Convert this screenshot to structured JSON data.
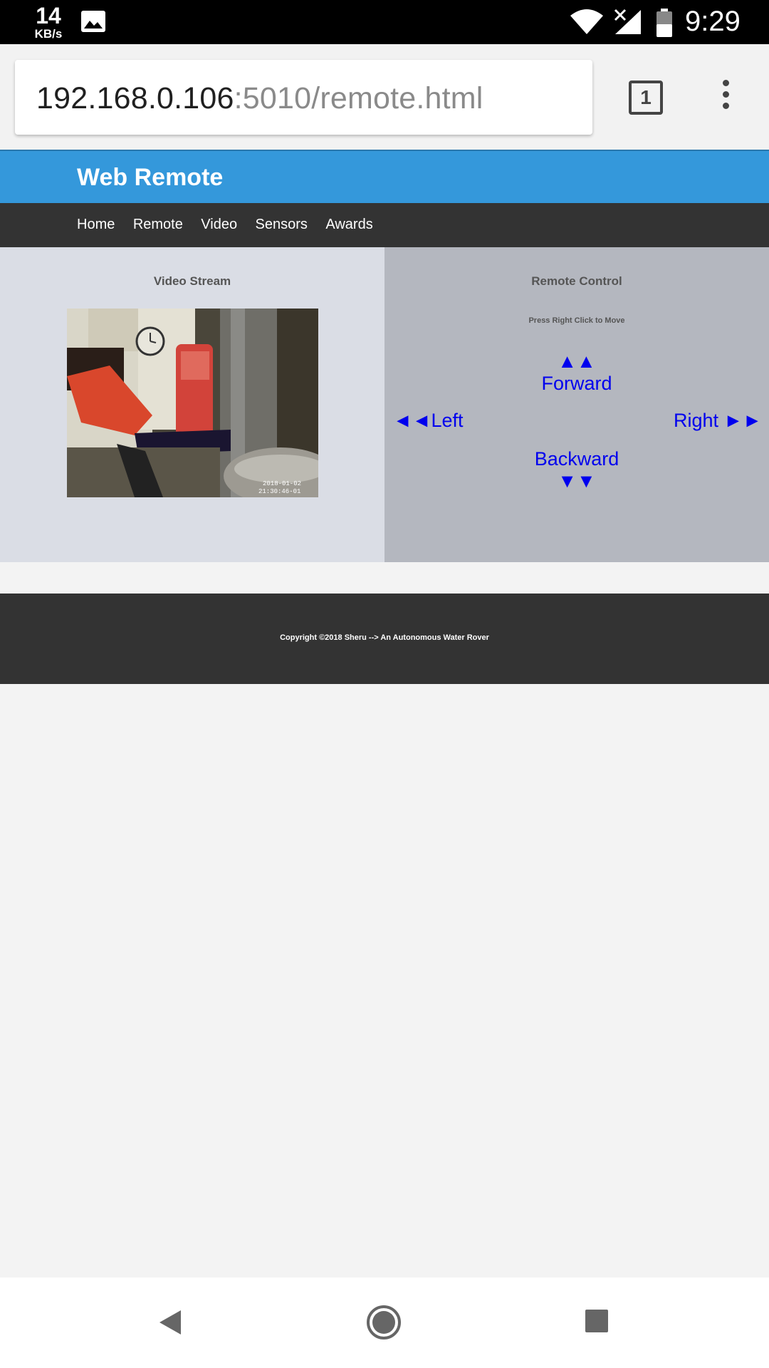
{
  "status_bar": {
    "net_speed": "14",
    "net_unit": "KB/s",
    "time": "9:29",
    "icons": [
      "gallery-icon",
      "wifi-icon",
      "signal-icon",
      "battery-icon"
    ]
  },
  "browser": {
    "url_host": "192.168.0.106",
    "url_path": ":5010/remote.html",
    "tab_count": "1"
  },
  "site": {
    "title": "Web Remote",
    "nav": [
      "Home",
      "Remote",
      "Video",
      "Sensors",
      "Awards"
    ],
    "colors": {
      "header": "#3498db",
      "nav": "#333333",
      "link": "#0000ee"
    }
  },
  "video_panel": {
    "title": "Video Stream",
    "timestamp_line1": "2018-01-02",
    "timestamp_line2": "21:30:46-01"
  },
  "remote_panel": {
    "title": "Remote Control",
    "hint": "Press Right Click to Move",
    "forward_arrows": "▲▲",
    "forward": "Forward",
    "left_arrows": "◄◄",
    "left": "Left",
    "right": "Right",
    "right_arrows": "►►",
    "backward": "Backward",
    "backward_arrows": "▼▼"
  },
  "footer": {
    "copyright": "Copyright ©2018 Sheru --> An Autonomous Water Rover"
  },
  "system_nav": {
    "icons": [
      "back-icon",
      "home-icon",
      "recents-icon"
    ]
  }
}
